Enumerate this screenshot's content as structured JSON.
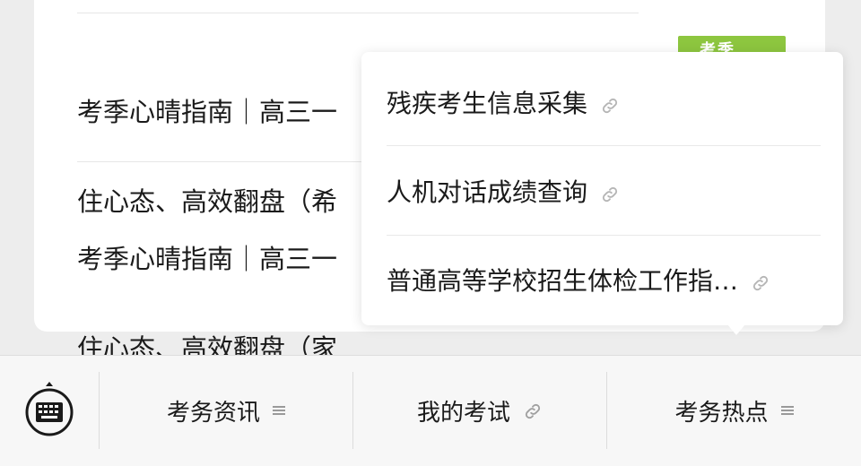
{
  "articles": [
    {
      "line1": "考季心晴指南｜高三一",
      "line2": "住心态、高效翻盘（希"
    },
    {
      "line1": "考季心晴指南｜高三一",
      "line2": "住心态、高效翻盘（家"
    }
  ],
  "thumbnail": {
    "text": "考季",
    "bg_color": "#8dc63f"
  },
  "popup_menu": {
    "items": [
      {
        "label": "残疾考生信息采集",
        "icon": "link-icon"
      },
      {
        "label": "人机对话成绩查询",
        "icon": "link-icon"
      },
      {
        "label": "普通高等学校招生体检工作指…",
        "icon": "link-icon"
      }
    ]
  },
  "bottom_bar": {
    "keyboard_icon": "keyboard-icon",
    "tabs": [
      {
        "label": "考务资讯",
        "icon": "menu-icon"
      },
      {
        "label": "我的考试",
        "icon": "link-icon"
      },
      {
        "label": "考务热点",
        "icon": "menu-icon"
      }
    ]
  },
  "colors": {
    "background": "#ededed",
    "card": "#ffffff",
    "text": "#1a1a1a",
    "icon_gray": "#b5b5b5"
  }
}
